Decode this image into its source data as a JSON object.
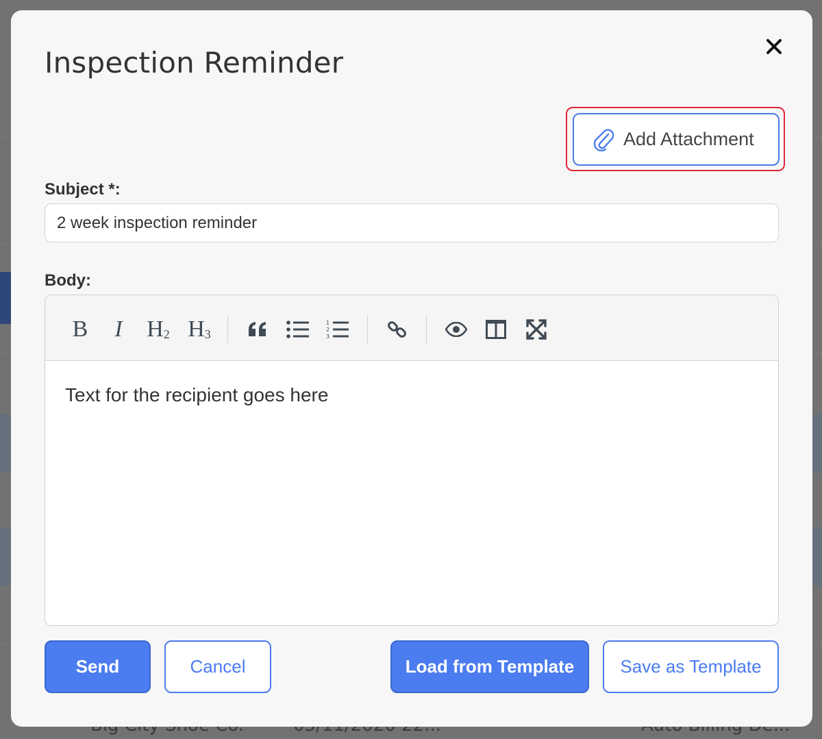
{
  "background": {
    "footer_cells": [
      "Big City Shoe Co.",
      "05/11/2020 22...",
      "Auto Billing De..."
    ]
  },
  "modal": {
    "title": "Inspection Reminder",
    "close_glyph": "✕",
    "add_attachment_label": "Add Attachment",
    "subject": {
      "label": "Subject *:",
      "value": "2 week inspection reminder"
    },
    "body": {
      "label": "Body:",
      "content": "Text for the recipient goes here"
    },
    "toolbar": {
      "bold": "B",
      "italic": "I",
      "heading2": "H",
      "heading2_sub": "2",
      "heading3": "H",
      "heading3_sub": "3"
    },
    "buttons": {
      "send": "Send",
      "cancel": "Cancel",
      "load_template": "Load from Template",
      "save_template": "Save as Template"
    }
  },
  "colors": {
    "accent": "#4b7cf0",
    "highlight": "#e0263a",
    "modal_bg": "#f7f7f7"
  },
  "icons": [
    "close-icon",
    "paperclip-icon",
    "quote-icon",
    "unordered-list-icon",
    "ordered-list-icon",
    "link-icon",
    "preview-icon",
    "side-by-side-icon",
    "fullscreen-icon"
  ]
}
